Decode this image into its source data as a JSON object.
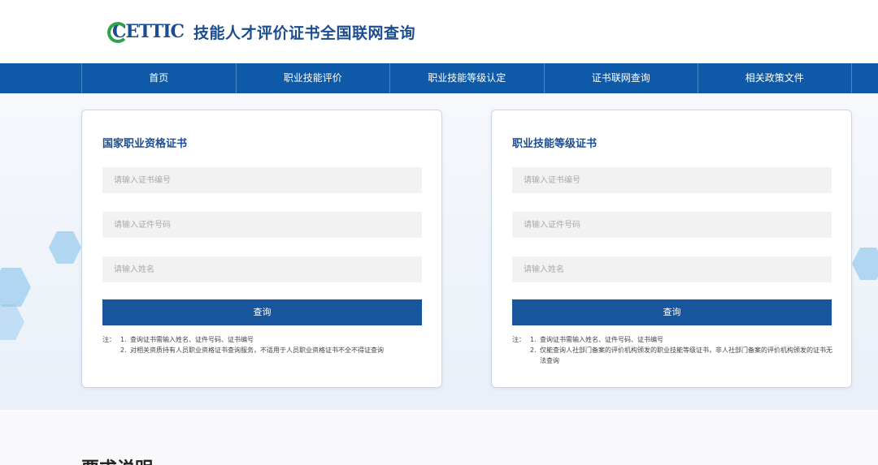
{
  "header": {
    "logo_text": "CETTIC",
    "site_title": "技能人才评价证书全国联网查询"
  },
  "nav": {
    "items": [
      "首页",
      "职业技能评价",
      "职业技能等级认定",
      "证书联网查询",
      "相关政策文件"
    ]
  },
  "cards": [
    {
      "title": "国家职业资格证书",
      "placeholders": [
        "请输入证书编号",
        "请输入证件号码",
        "请输入姓名"
      ],
      "button": "查询",
      "notes_label": "注：",
      "notes": [
        {
          "num": "1.",
          "text": "查询证书需输入姓名、证件号码、证书编号"
        },
        {
          "num": "2.",
          "text": "对相关资质持有人员职业资格证书查询服务，不适用于人员职业资格证书不全不得证查询"
        }
      ]
    },
    {
      "title": "职业技能等级证书",
      "placeholders": [
        "请输入证书编号",
        "请输入证件号码",
        "请输入姓名"
      ],
      "button": "查询",
      "notes_label": "注：",
      "notes": [
        {
          "num": "1.",
          "text": "查询证书需输入姓名、证件号码、证书编号"
        },
        {
          "num": "2.",
          "text": "仅能查询人社部门备案的评价机构颁发的职业技能等级证书，非人社部门备案的评价机构颁发的证书无法查询"
        }
      ]
    }
  ],
  "section_title": "要求说明",
  "colors": {
    "nav_bg": "#0e5aa8",
    "brand_blue": "#1b4d8f",
    "button_bg": "#17569c",
    "logo_green": "#2fa24a"
  }
}
